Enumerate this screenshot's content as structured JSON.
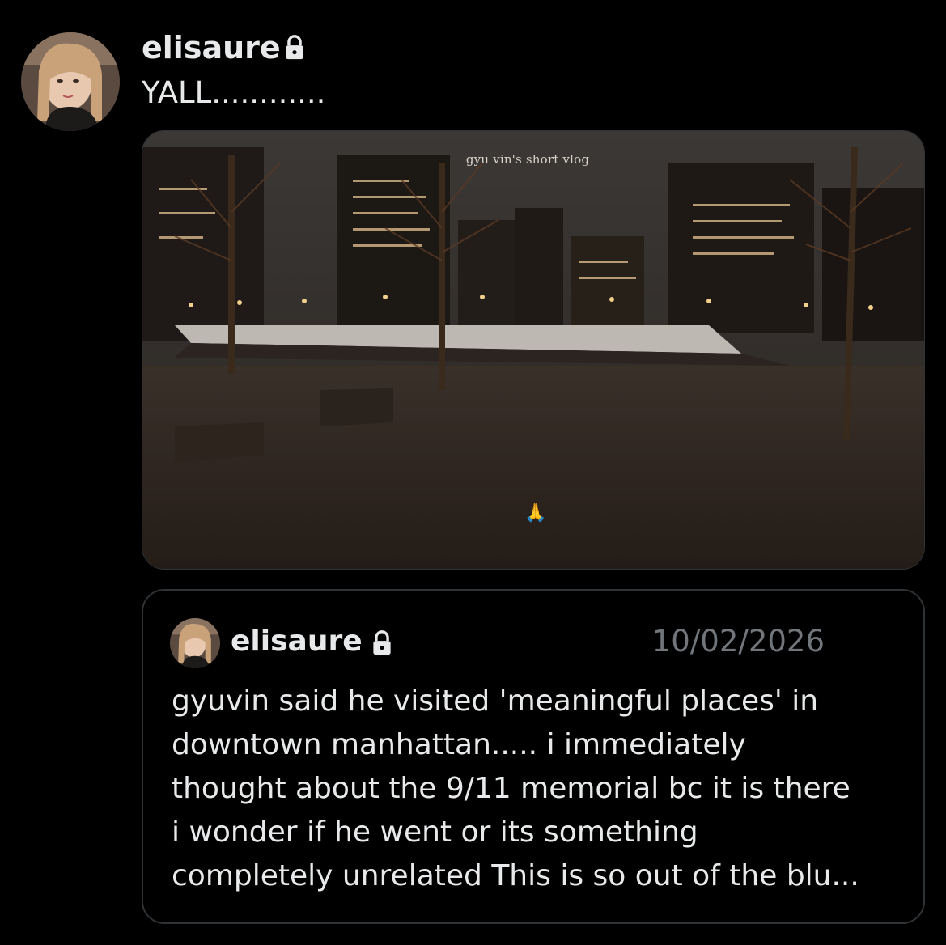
{
  "post": {
    "author": "elisaure",
    "author_icon": "lock-icon",
    "text": "YALL............"
  },
  "media": {
    "caption": "gyu vin's short vlog",
    "emoji": "🙏"
  },
  "quote": {
    "author": "elisaure",
    "author_icon": "lock-icon",
    "date": "10/02/2026",
    "lines": [
      "gyuvin said he visited 'meaningful places' in",
      "downtown manhattan..... i immediately",
      "thought about the 9/11 memorial bc it is there",
      "i wonder if he went or its something",
      "completely unrelated This is so out of the blu..."
    ]
  },
  "colors": {
    "background": "#000000",
    "text": "#e7e9ea",
    "muted": "#71767b",
    "border": "#2f3336"
  }
}
